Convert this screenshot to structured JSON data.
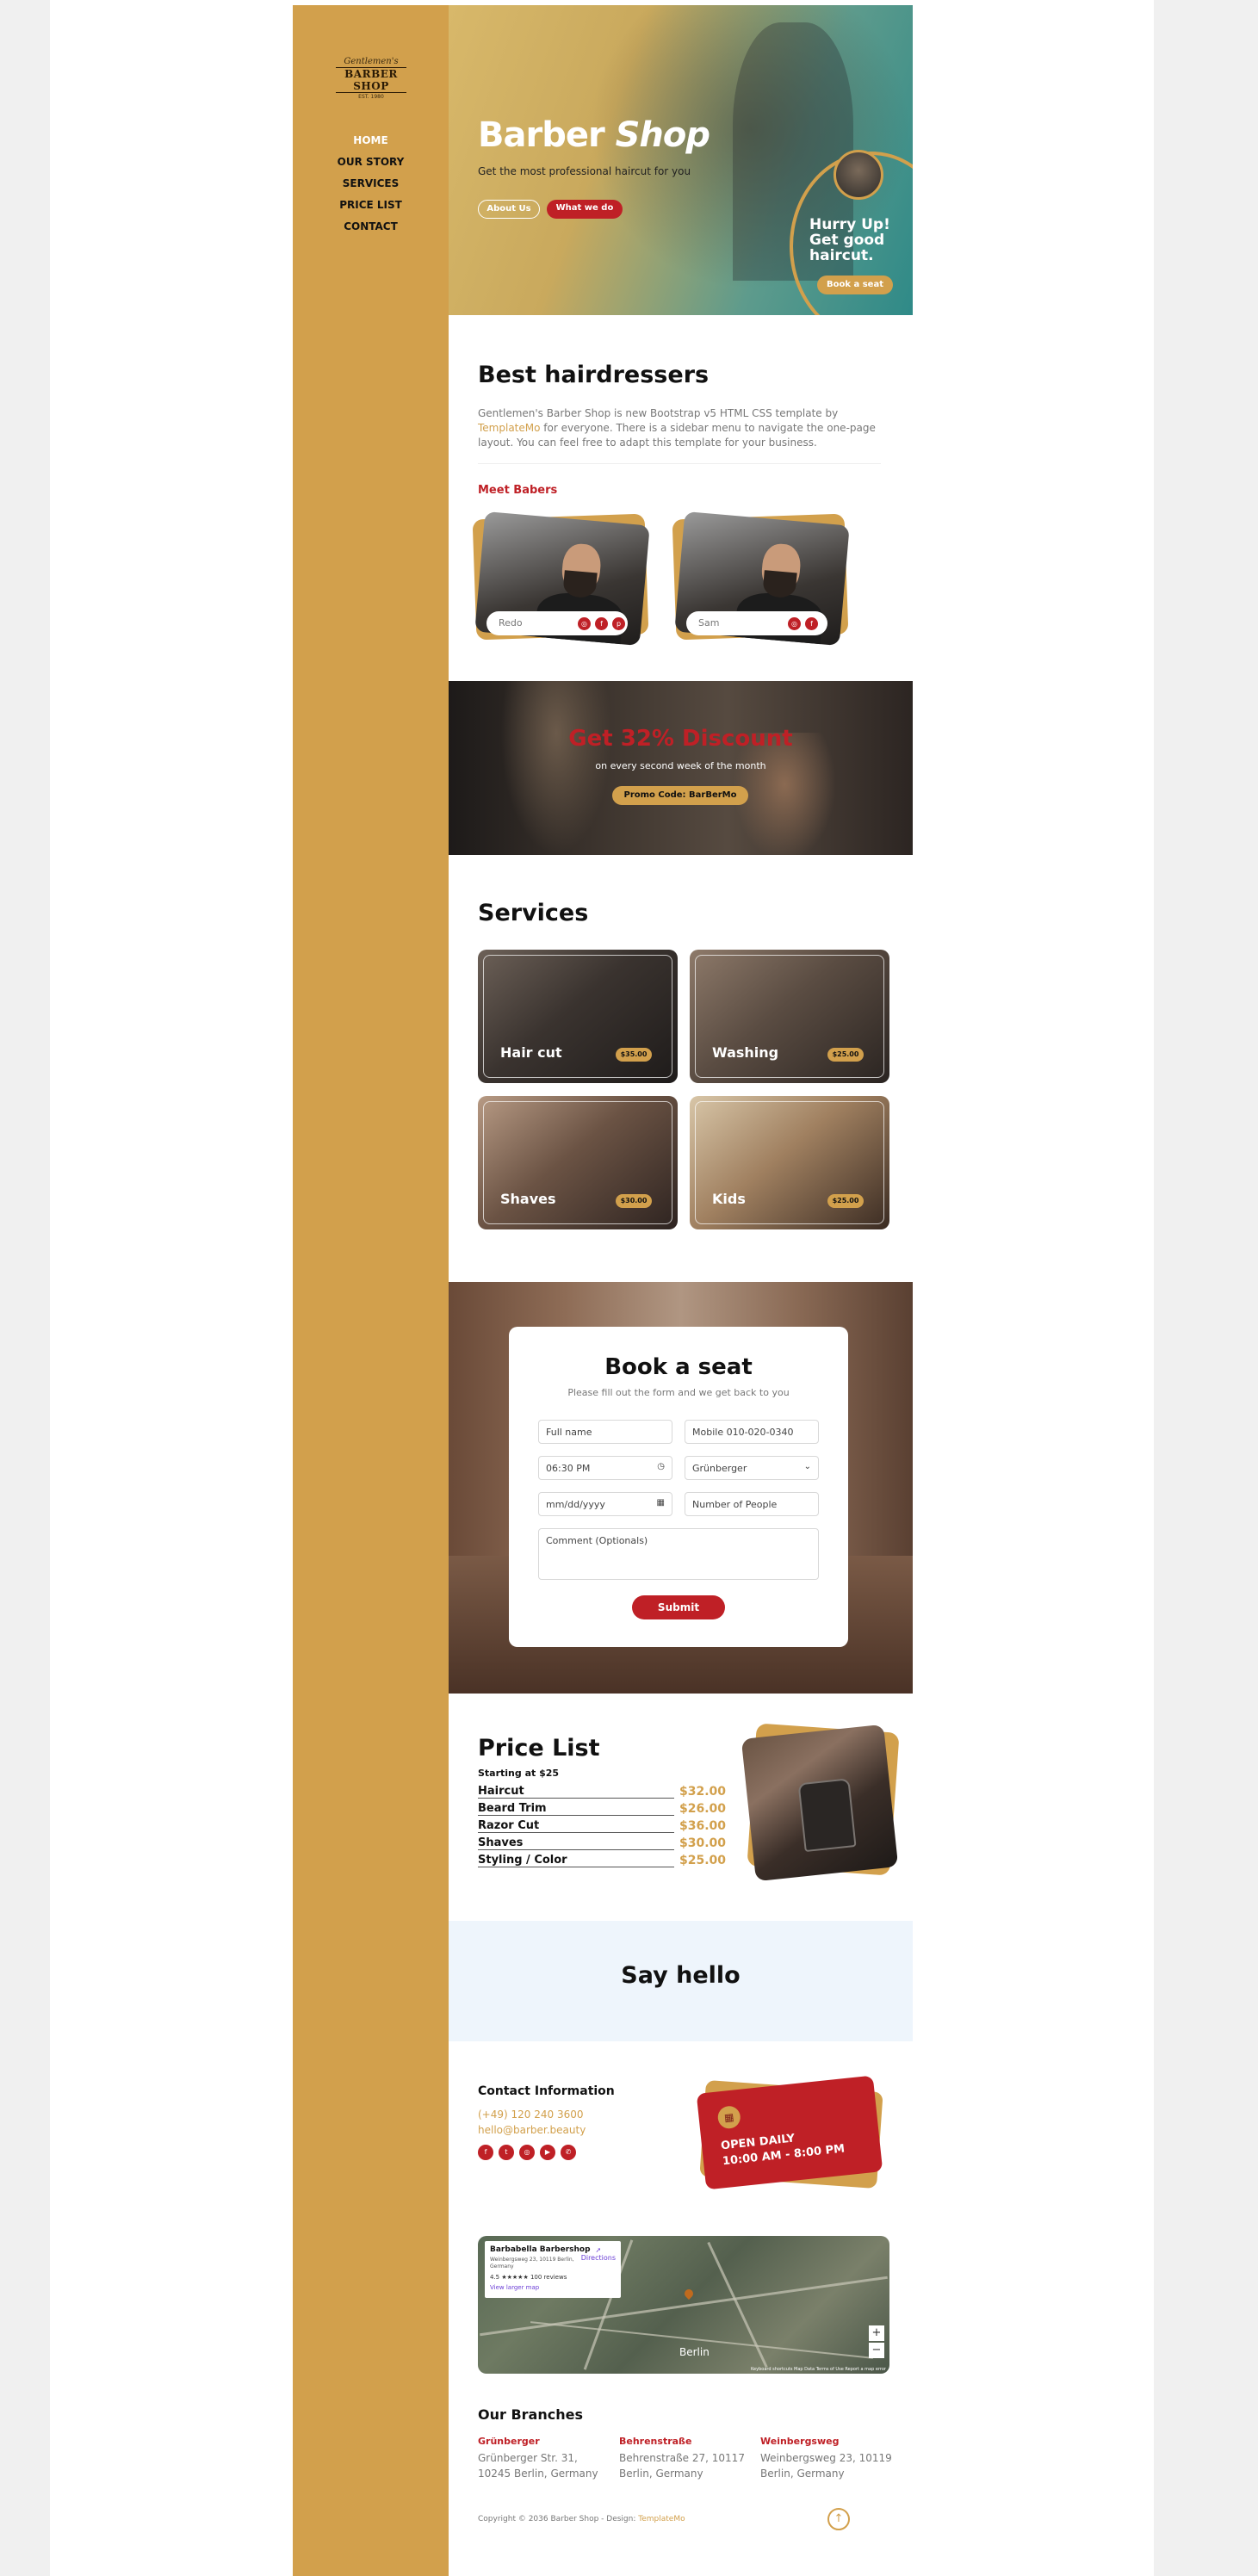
{
  "sidebar": {
    "logo": {
      "line1": "Gentlemen's",
      "line2": "BARBER SHOP",
      "line3": "EST. 1980"
    },
    "nav": [
      "HOME",
      "OUR STORY",
      "SERVICES",
      "PRICE LIST",
      "CONTACT"
    ]
  },
  "hero": {
    "title_a": "Barber ",
    "title_b": "Shop",
    "subtitle": "Get the most professional haircut for you",
    "btn_about": "About Us",
    "btn_what": "What we do",
    "hurry_text": "Hurry Up! Get good haircut.",
    "hurry_btn": "Book a seat"
  },
  "about": {
    "title": "Best hairdressers",
    "text_a": "Gentlemen's Barber Shop is new Bootstrap v5 HTML CSS template by ",
    "text_link": "TemplateMo",
    "text_b": " for everyone. There is a sidebar menu to navigate the one-page layout. You can feel free to adapt this template for your business.",
    "meet": "Meet Babers",
    "barbers": [
      {
        "name": "Redo"
      },
      {
        "name": "Sam"
      }
    ]
  },
  "discount": {
    "title": "Get 32% Discount",
    "subtitle": "on every second week of the month",
    "code": "Promo Code: BarBerMo"
  },
  "services": {
    "title": "Services",
    "items": [
      {
        "name": "Hair cut",
        "price": "$35.00"
      },
      {
        "name": "Washing",
        "price": "$25.00"
      },
      {
        "name": "Shaves",
        "price": "$30.00"
      },
      {
        "name": "Kids",
        "price": "$25.00"
      }
    ]
  },
  "booking": {
    "title": "Book a seat",
    "subtitle": "Please fill out the form and we get back to you",
    "full_name": "Full name",
    "mobile": "Mobile 010-020-0340",
    "time": "06:30 PM",
    "branch": "Grünberger",
    "date": "mm/dd/yyyy",
    "people": "Number of People",
    "comment": "Comment (Optionals)",
    "submit": "Submit"
  },
  "prices": {
    "title": "Price List",
    "starting": "Starting at $25",
    "items": [
      {
        "name": "Haircut",
        "value": "$32.00"
      },
      {
        "name": "Beard Trim",
        "value": "$26.00"
      },
      {
        "name": "Razor Cut",
        "value": "$36.00"
      },
      {
        "name": "Shaves",
        "value": "$30.00"
      },
      {
        "name": "Styling / Color",
        "value": "$25.00"
      }
    ]
  },
  "hello": {
    "title": "Say hello"
  },
  "contact": {
    "title": "Contact Information",
    "phone": "(+49) 120 240 3600",
    "email": "hello@barber.beauty",
    "open_title": "OPEN DAILY",
    "open_hours": "10:00 AM - 8:00 PM"
  },
  "map": {
    "place": "Barbabella Barbershop",
    "address": "Weinbergsweg 23, 10119 Berlin, Germany",
    "rating": "4.5 ★★★★★  100 reviews",
    "larger": "View larger map",
    "directions": "Directions",
    "city": "Berlin",
    "attribution": "Keyboard shortcuts  Map Data  Terms of Use  Report a map error"
  },
  "branches": {
    "title": "Our Branches",
    "items": [
      {
        "name": "Grünberger",
        "line1": "Grünberger Str. 31,",
        "line2": "10245 Berlin, Germany"
      },
      {
        "name": "Behrenstraße",
        "line1": "Behrenstraße 27, 10117",
        "line2": "Berlin, Germany"
      },
      {
        "name": "Weinbergsweg",
        "line1": "Weinbergsweg 23, 10119",
        "line2": "Berlin, Germany"
      }
    ],
    "copyright": "Copyright © 2036 Barber Shop - Design: ",
    "copyright_link": "TemplateMo"
  },
  "colors": {
    "gold": "#d2a04c",
    "red": "#bf2026",
    "hello_bg": "#eef5fc"
  }
}
